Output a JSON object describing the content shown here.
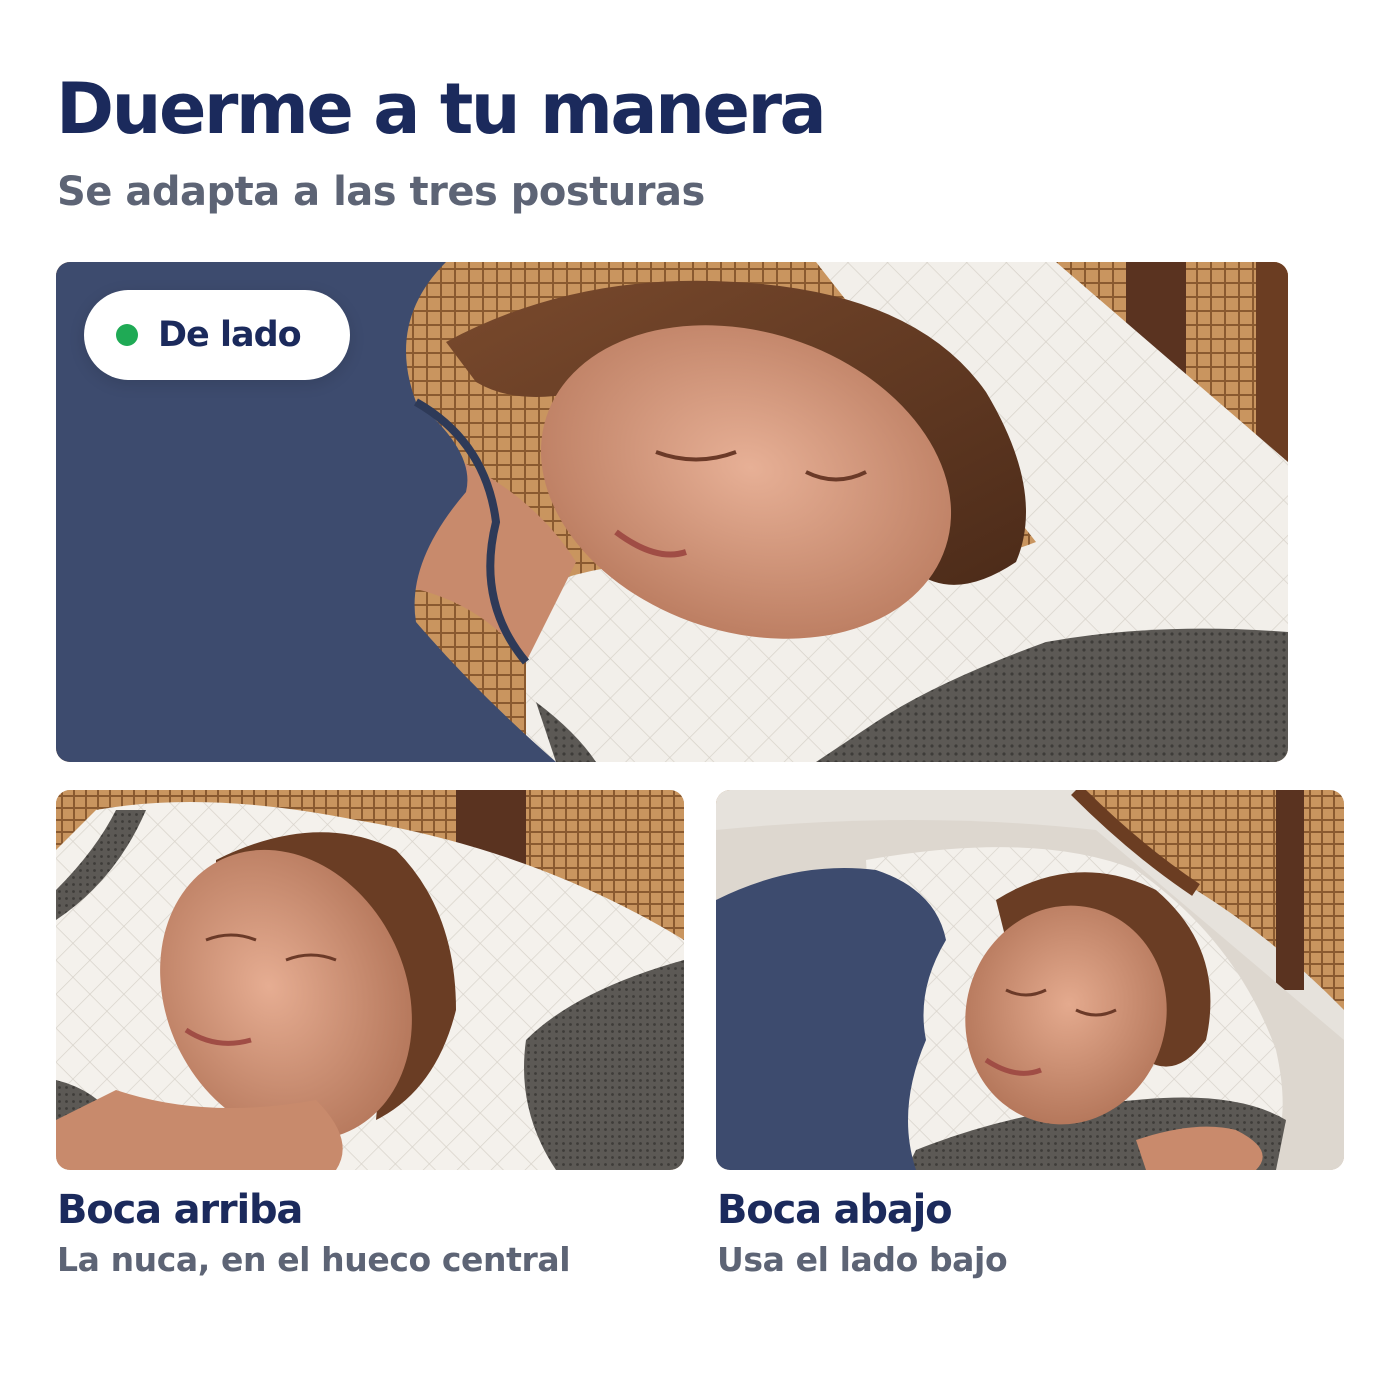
{
  "header": {
    "title": "Duerme a tu manera",
    "subtitle": "Se adapta a las tres posturas"
  },
  "hero": {
    "badge_label": "De lado",
    "badge_dot_color": "#1faa55"
  },
  "cards": [
    {
      "title": "Boca arriba",
      "caption": "La nuca, en el hueco central"
    },
    {
      "title": "Boca abajo",
      "caption": "Usa el lado bajo"
    }
  ],
  "colors": {
    "heading": "#1b2a5c",
    "subheading": "#5d6475",
    "accent_green": "#1faa55"
  }
}
